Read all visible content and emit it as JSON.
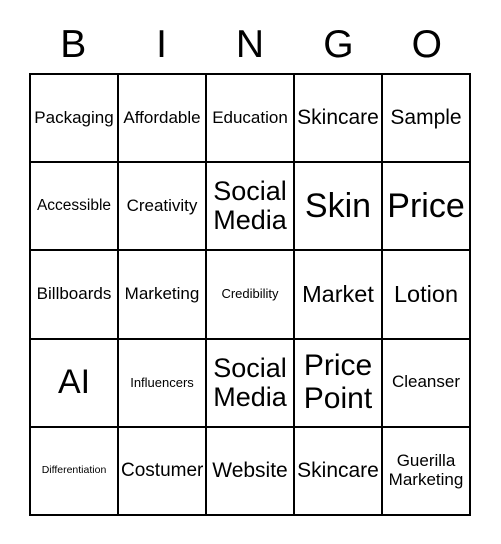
{
  "card": {
    "title": "BINGO",
    "header_letters": [
      "B",
      "I",
      "N",
      "G",
      "O"
    ],
    "grid": {
      "rows": 5,
      "columns": 5,
      "line_color": "#000000",
      "background_color": "#ffffff",
      "text_color": "#000000",
      "cells": [
        [
          {
            "text": "Packaging",
            "size": "fs-m"
          },
          {
            "text": "Affordable",
            "size": "fs-m"
          },
          {
            "text": "Education",
            "size": "fs-m"
          },
          {
            "text": "Skincare",
            "size": "fs-l"
          },
          {
            "text": "Sample",
            "size": "fs-l"
          }
        ],
        [
          {
            "text": "Accessible",
            "size": "fs-s"
          },
          {
            "text": "Creativity",
            "size": "fs-m"
          },
          {
            "text": "Social Media",
            "size": "fs-xxl"
          },
          {
            "text": "Skin",
            "size": "fs-4xl"
          },
          {
            "text": "Price",
            "size": "fs-4xl"
          }
        ],
        [
          {
            "text": "Billboards",
            "size": "fs-m"
          },
          {
            "text": "Marketing",
            "size": "fs-m"
          },
          {
            "text": "Credibility",
            "size": "fs-xs"
          },
          {
            "text": "Market",
            "size": "fs-xl"
          },
          {
            "text": "Lotion",
            "size": "fs-xl"
          }
        ],
        [
          {
            "text": "AI",
            "size": "fs-4xl"
          },
          {
            "text": "Influencers",
            "size": "fs-xs"
          },
          {
            "text": "Social Media",
            "size": "fs-xxl"
          },
          {
            "text": "Price Point",
            "size": "fs-3xl"
          },
          {
            "text": "Cleanser",
            "size": "fs-m"
          }
        ],
        [
          {
            "text": "Differentiation",
            "size": "fs-xxs"
          },
          {
            "text": "Costumer",
            "size": "fs-ml"
          },
          {
            "text": "Website",
            "size": "fs-l"
          },
          {
            "text": "Skincare",
            "size": "fs-l"
          },
          {
            "text": "Guerilla Marketing",
            "size": "fs-m"
          }
        ]
      ]
    }
  }
}
